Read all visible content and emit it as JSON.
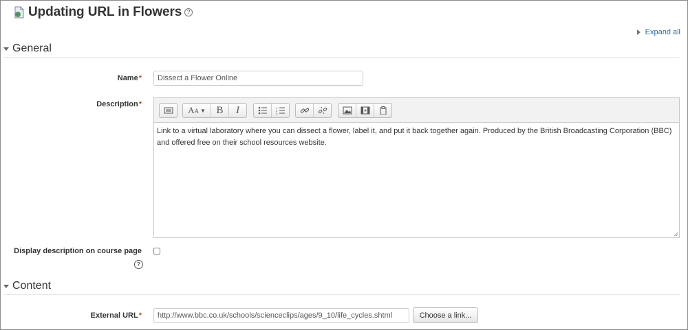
{
  "page": {
    "title": "Updating URL in Flowers",
    "expand_all": "Expand all"
  },
  "general": {
    "section_title": "General",
    "name_label": "Name",
    "name_value": "Dissect a Flower Online",
    "description_label": "Description",
    "description_text": "Link to a virtual laboratory where you can dissect a flower, label it, and put it back together again. Produced by the British Broadcasting Corporation (BBC) and offered free on their school resources website.",
    "display_desc_label": "Display description on course page",
    "display_desc_checked": false
  },
  "content": {
    "section_title": "Content",
    "external_url_label": "External URL",
    "external_url_value": "http://www.bbc.co.uk/schools/scienceclips/ages/9_10/life_cycles.shtml",
    "choose_link_label": "Choose a link..."
  },
  "required_marker": "*",
  "editor_toolbar": {
    "groups": [
      [
        "toggle-toolbar-icon"
      ],
      [
        "font-style-icon",
        "bold-icon",
        "italic-icon"
      ],
      [
        "unordered-list-icon",
        "ordered-list-icon"
      ],
      [
        "link-icon",
        "unlink-icon"
      ],
      [
        "image-icon",
        "media-icon",
        "paste-icon"
      ]
    ]
  },
  "colors": {
    "link": "#2f6aa5",
    "required": "#b94a48",
    "toolbar_bg": "#f2f2f2"
  }
}
